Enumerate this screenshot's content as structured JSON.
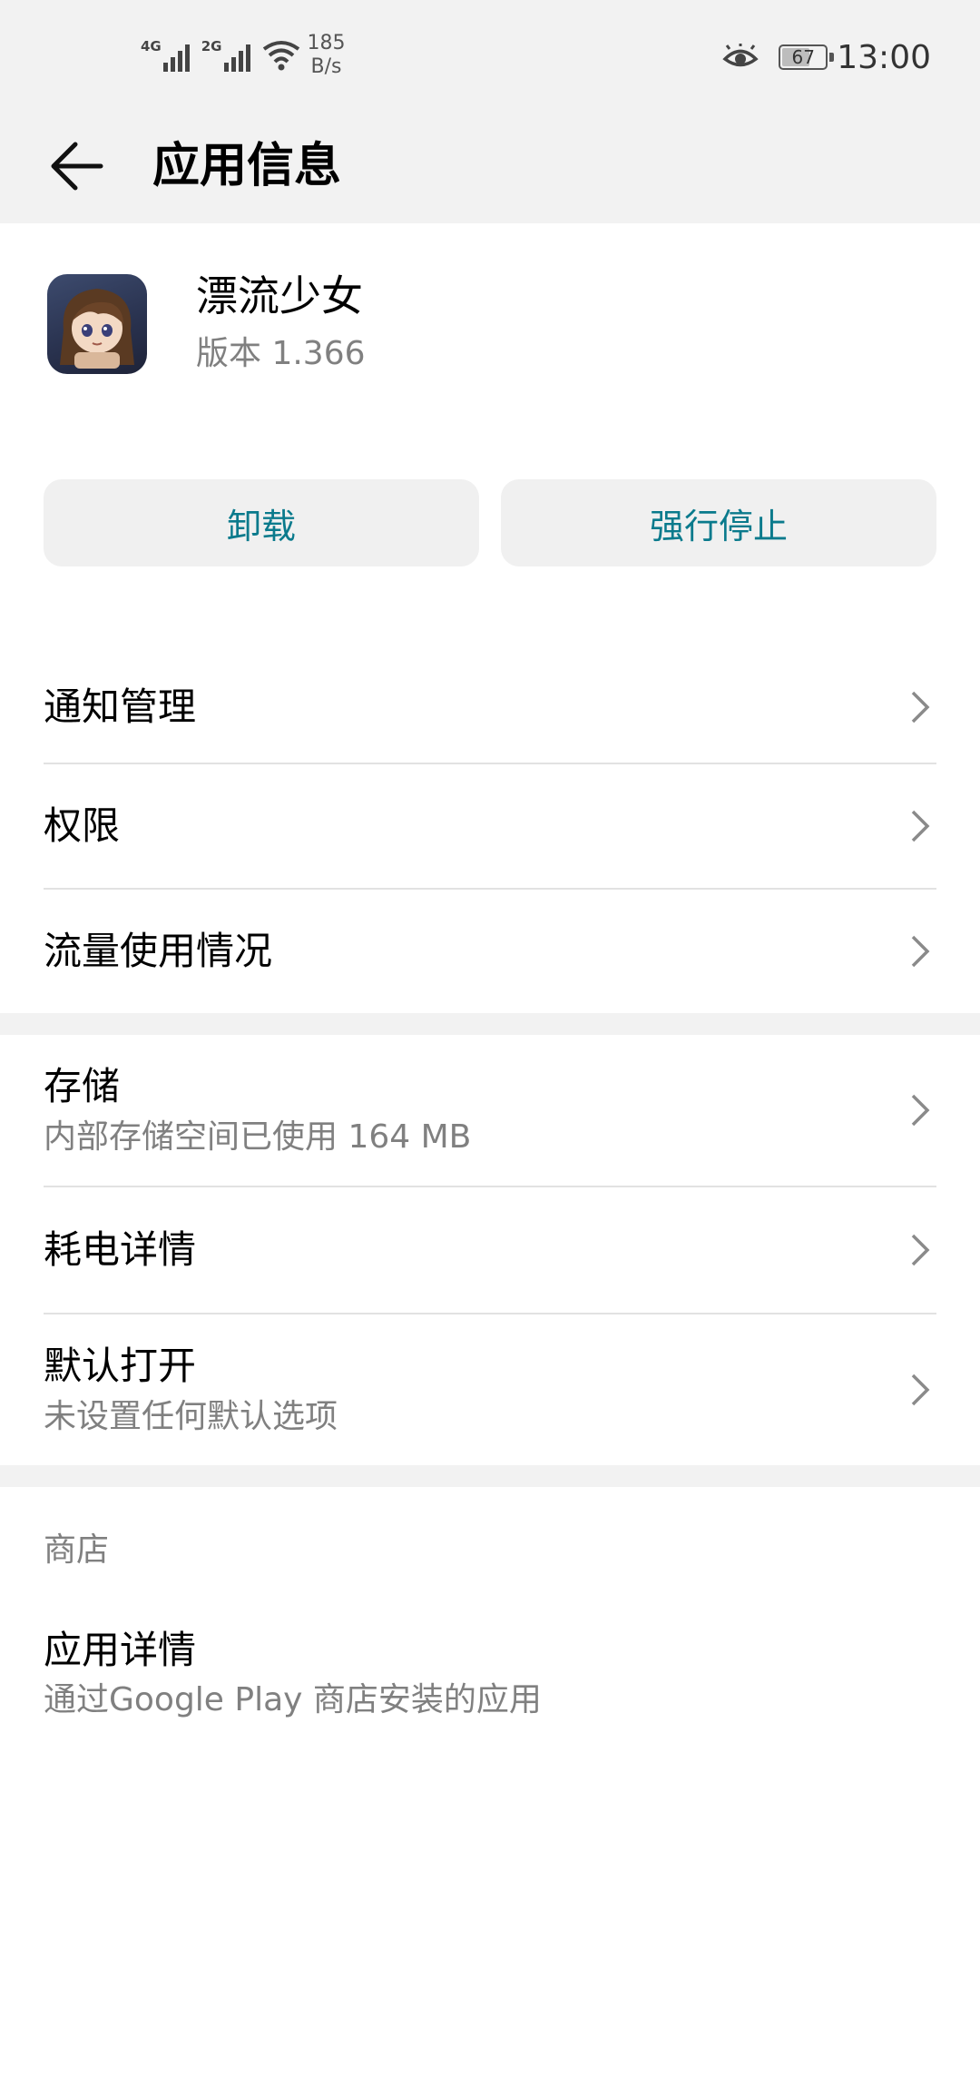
{
  "status_bar": {
    "net1": "4G",
    "net2": "2G",
    "speed_value": "185",
    "speed_unit": "B/s",
    "battery_level": "67",
    "time": "13:00",
    "icons": [
      "signal-icon",
      "wifi-icon",
      "eye-comfort-icon",
      "battery-icon"
    ]
  },
  "header": {
    "title": "应用信息"
  },
  "app": {
    "name": "漂流少女",
    "version": "版本 1.366"
  },
  "actions": {
    "uninstall": "卸载",
    "force_stop": "强行停止",
    "accent_color": "#0a7a8c"
  },
  "list": {
    "notifications": "通知管理",
    "permissions": "权限",
    "data_usage": "流量使用情况",
    "storage": "存储",
    "storage_sub": "内部存储空间已使用 164 MB",
    "battery": "耗电详情",
    "open_default": "默认打开",
    "open_default_sub": "未设置任何默认选项"
  },
  "store": {
    "section_title": "商店",
    "app_details": "应用详情",
    "app_details_sub": "通过Google Play 商店安装的应用"
  }
}
